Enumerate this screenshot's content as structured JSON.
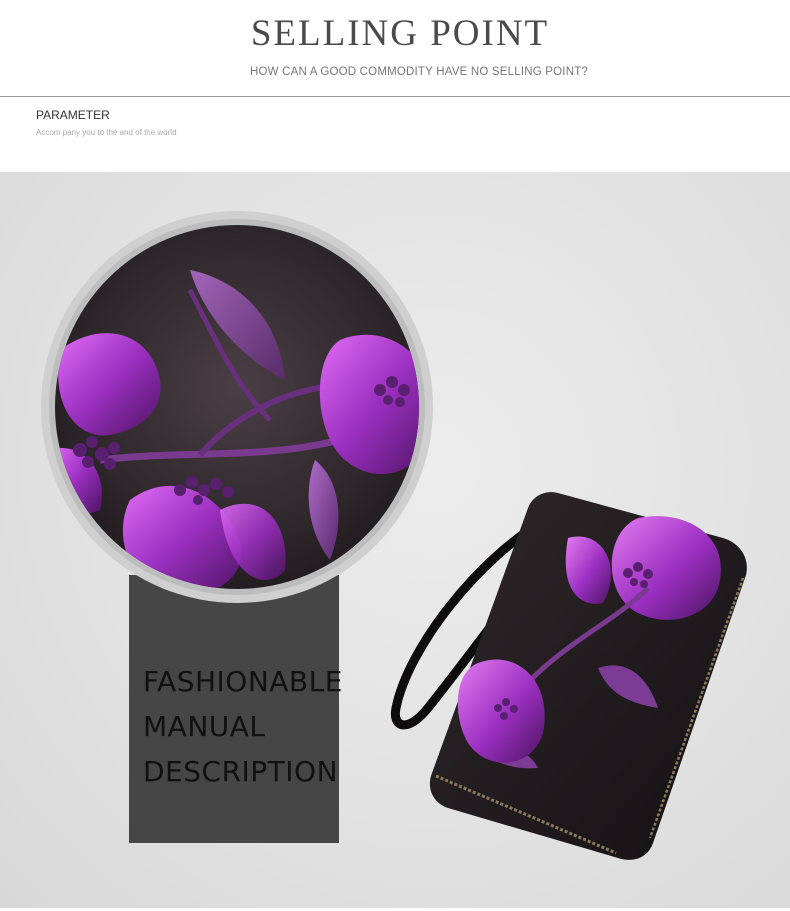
{
  "header": {
    "title": "SELLING POINT",
    "subtitle": "HOW CAN A GOOD COMMODITY HAVE NO SELLING POINT?"
  },
  "parameter": {
    "label": "PARAMETER",
    "sub": "Accom pany you to the and of the world"
  },
  "feature": {
    "lines": [
      "FASHIONABLE",
      "MANUAL",
      "DESCRIPTION"
    ]
  },
  "colors": {
    "accent_purple": "#9a2fc0",
    "leather_dark": "#2a2326",
    "box_gray": "#464646",
    "background_gray": "#e1e1e1"
  }
}
